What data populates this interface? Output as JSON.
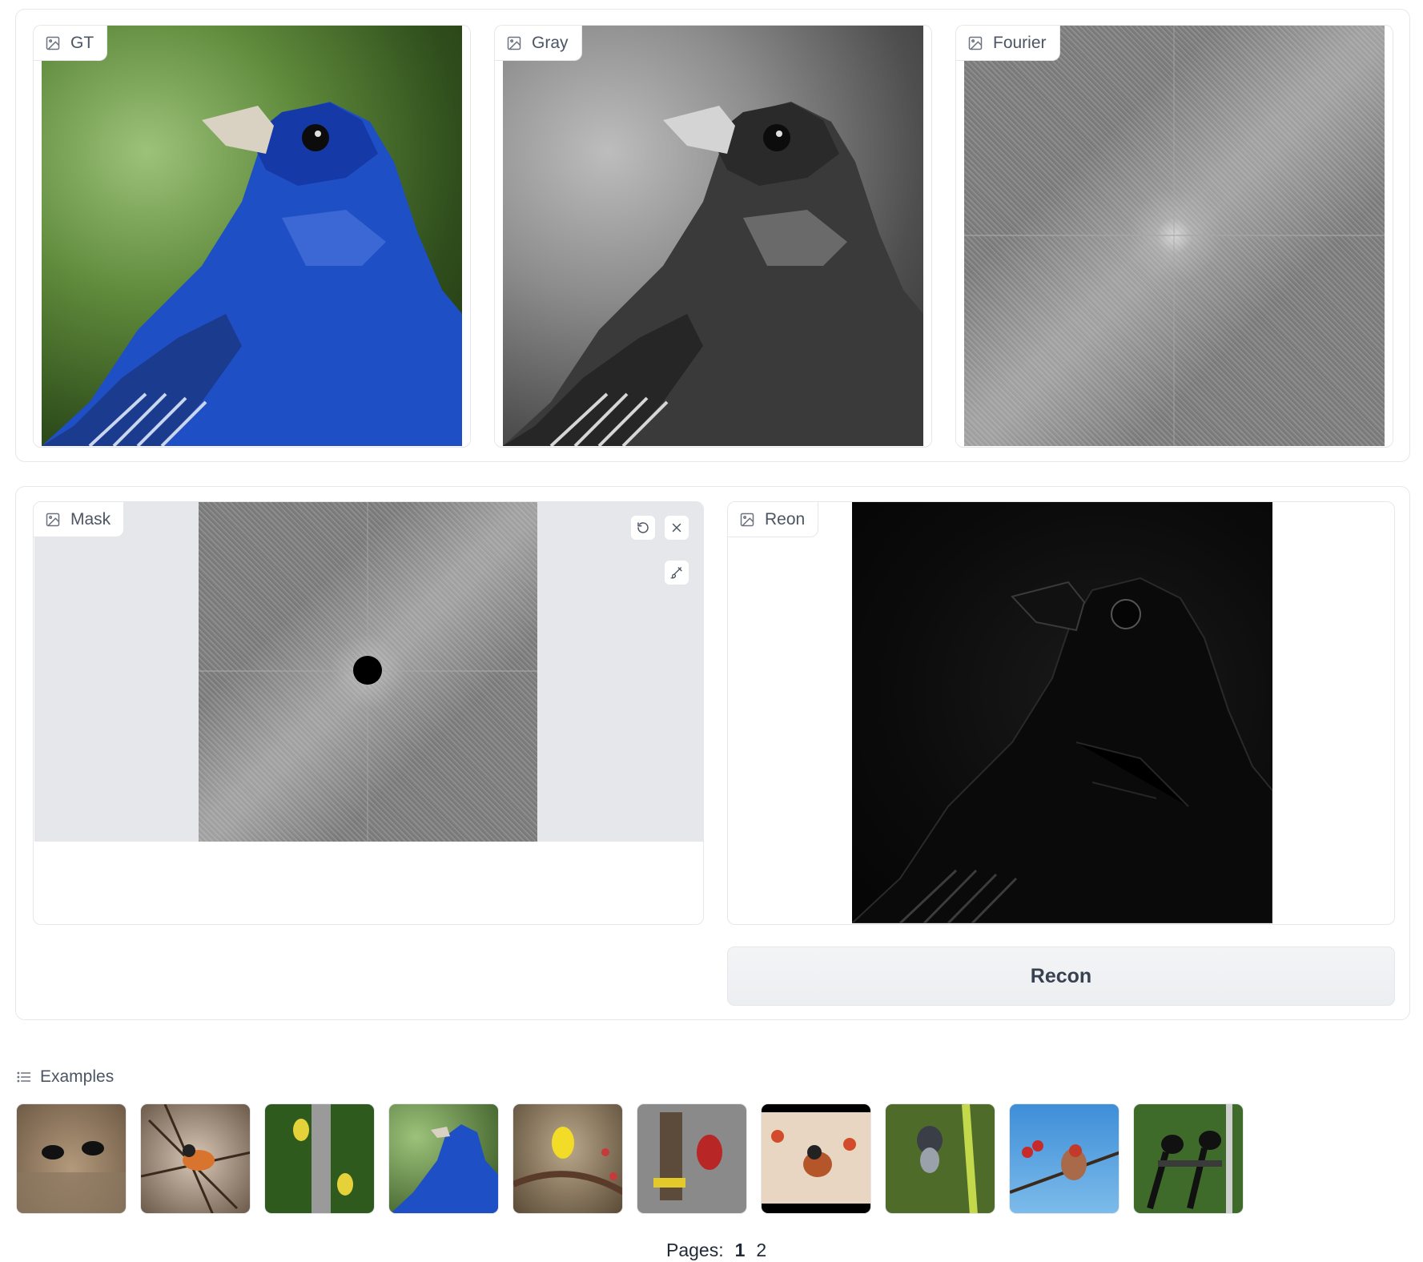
{
  "top_row": {
    "panels": [
      {
        "label": "GT"
      },
      {
        "label": "Gray"
      },
      {
        "label": "Fourier"
      }
    ]
  },
  "mask_panel": {
    "label": "Mask"
  },
  "recon_panel": {
    "label": "Reon"
  },
  "recon_button": {
    "label": "Recon"
  },
  "examples": {
    "label": "Examples",
    "thumbnails": [
      {
        "subject": "magpies-by-water"
      },
      {
        "subject": "brambling-in-branches"
      },
      {
        "subject": "goldfinches-on-feeder"
      },
      {
        "subject": "indigo-bunting"
      },
      {
        "subject": "goldfinch-on-branch"
      },
      {
        "subject": "house-finch-on-feeder"
      },
      {
        "subject": "robin-in-berries"
      },
      {
        "subject": "junco-in-shrub"
      },
      {
        "subject": "house-finch-with-berries"
      },
      {
        "subject": "magpies-on-feeder"
      }
    ]
  },
  "pagination": {
    "label": "Pages:",
    "pages": [
      "1",
      "2"
    ]
  }
}
